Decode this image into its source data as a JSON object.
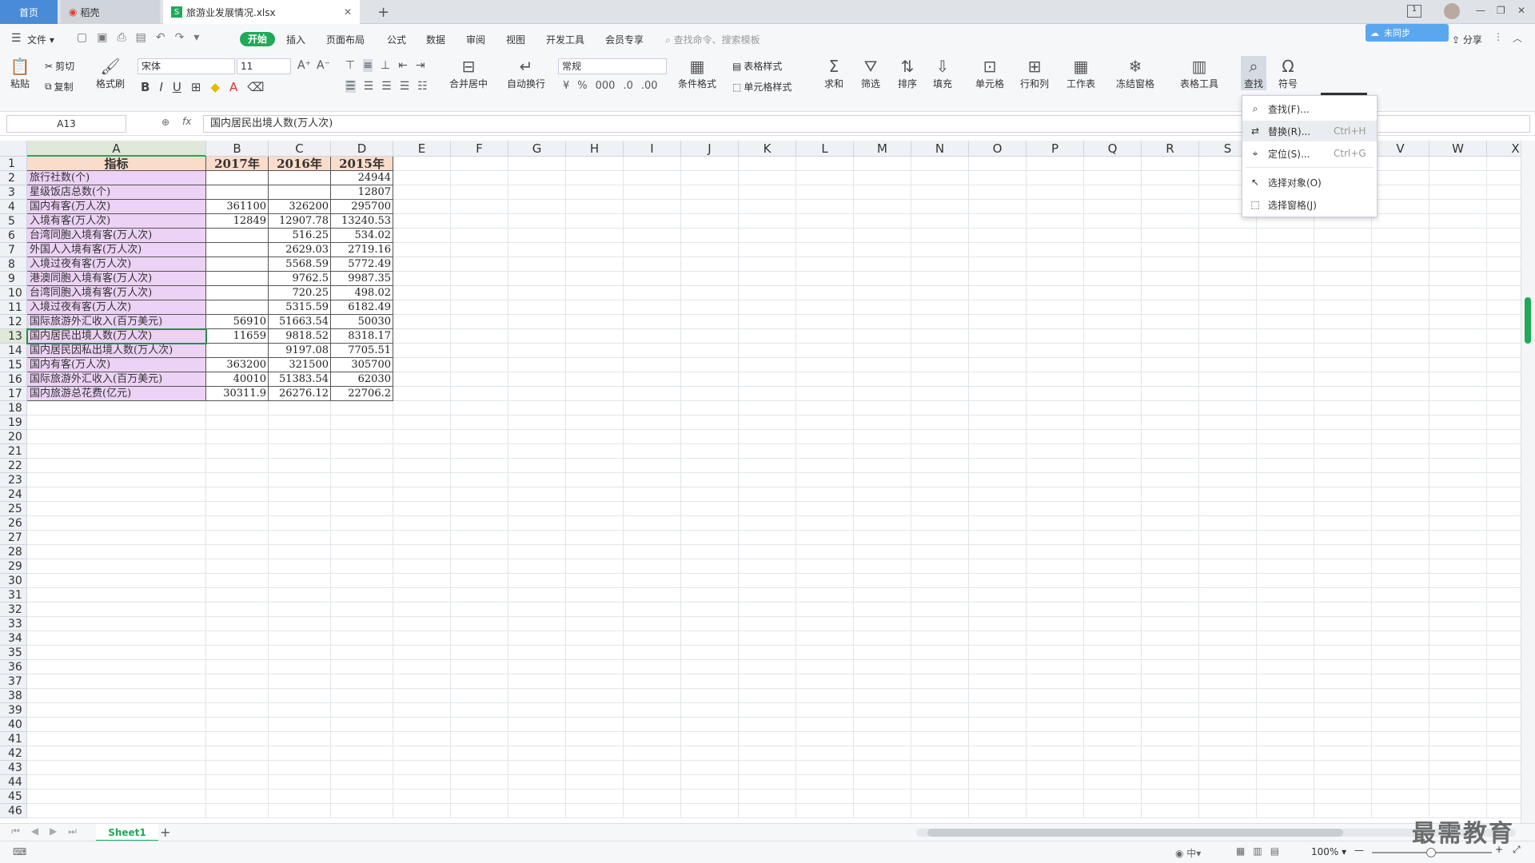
{
  "tabs": {
    "home": "首页",
    "daoke": "稻壳",
    "file": "旅游业发展情况.xlsx",
    "new_tab": "+"
  },
  "window_controls": {
    "min": "—",
    "max": "❐",
    "close": "✕"
  },
  "menu": {
    "file": "文件",
    "items": [
      "开始",
      "插入",
      "页面布局",
      "公式",
      "数据",
      "审阅",
      "视图",
      "开发工具",
      "会员专享"
    ],
    "search_placeholder": "查找命令、搜索模板",
    "share": "分享",
    "collab": "未同步"
  },
  "ribbon": {
    "paste": "粘贴",
    "cut": "剪切",
    "copy": "复制",
    "format_painter": "格式刷",
    "font_name": "宋体",
    "font_size": "11",
    "merge": "合并居中",
    "wrap": "自动换行",
    "number_format": "常规",
    "cond_format": "条件格式",
    "table_style": "表格样式",
    "cell_style": "单元格样式",
    "sum": "求和",
    "filter": "筛选",
    "sort": "排序",
    "fill": "填充",
    "cell": "单元格",
    "rowcol": "行和列",
    "sheet": "工作表",
    "freeze": "冻结窗格",
    "table_tools": "表格工具",
    "find": "查找",
    "symbol": "符号"
  },
  "formula": {
    "name_box": "A13",
    "fx": "fx",
    "content": "国内居民出境人数(万人次)"
  },
  "columns": [
    "A",
    "B",
    "C",
    "D",
    "E",
    "F",
    "G",
    "H",
    "I",
    "J",
    "K",
    "L",
    "M",
    "N",
    "O",
    "P",
    "Q",
    "R",
    "S",
    "T",
    "U",
    "V",
    "W",
    "X"
  ],
  "rows": [
    "1",
    "2",
    "3",
    "4",
    "5",
    "6",
    "7",
    "8",
    "9",
    "10",
    "11",
    "12",
    "13",
    "14",
    "15",
    "16",
    "17",
    "18",
    "19",
    "20",
    "21",
    "22",
    "23",
    "24",
    "25",
    "26",
    "27",
    "28",
    "29",
    "30",
    "31",
    "32",
    "33",
    "34",
    "35",
    "36",
    "37",
    "38",
    "39",
    "40",
    "41",
    "42",
    "43",
    "44",
    "45",
    "46"
  ],
  "table": {
    "header": [
      "指标",
      "2017年",
      "2016年",
      "2015年"
    ],
    "rows": [
      [
        "旅行社数(个)",
        "",
        "",
        "24944"
      ],
      [
        "星级饭店总数(个)",
        "",
        "",
        "12807"
      ],
      [
        "国内有客(万人次)",
        "361100",
        "326200",
        "295700"
      ],
      [
        "入境有客(万人次)",
        "12849",
        "12907.78",
        "13240.53"
      ],
      [
        "台湾同胞入境有客(万人次)",
        "",
        "516.25",
        "534.02"
      ],
      [
        "外国人入境有客(万人次)",
        "",
        "2629.03",
        "2719.16"
      ],
      [
        "入境过夜有客(万人次)",
        "",
        "5568.59",
        "5772.49"
      ],
      [
        "港澳同胞入境有客(万人次)",
        "",
        "9762.5",
        "9987.35"
      ],
      [
        "台湾同胞入境有客(万人次)",
        "",
        "720.25",
        "498.02"
      ],
      [
        "入境过夜有客(万人次)",
        "",
        "5315.59",
        "6182.49"
      ],
      [
        "国际旅游外汇收入(百万美元)",
        "56910",
        "51663.54",
        "50030"
      ],
      [
        "国内居民出境人数(万人次)",
        "11659",
        "9818.52",
        "8318.17"
      ],
      [
        "国内居民因私出境人数(万人次)",
        "",
        "9197.08",
        "7705.51"
      ],
      [
        "国内有客(万人次)",
        "363200",
        "321500",
        "305700"
      ],
      [
        "国际旅游外汇收入(百万美元)",
        "40010",
        "51383.54",
        "62030"
      ],
      [
        "国内旅游总花费(亿元)",
        "30311.9",
        "26276.12",
        "22706.2"
      ]
    ]
  },
  "find_menu": [
    {
      "label": "查找(F)...",
      "shortcut": ""
    },
    {
      "label": "替换(R)...",
      "shortcut": "Ctrl+H"
    },
    {
      "label": "定位(S)...",
      "shortcut": "Ctrl+G"
    },
    {
      "label": "选择对象(O)",
      "shortcut": ""
    },
    {
      "label": "选择窗格(J)",
      "shortcut": ""
    }
  ],
  "sheet": {
    "name": "Sheet1",
    "add": "+"
  },
  "status": {
    "zoom": "100%"
  },
  "watermark": "最需教育",
  "colors": {
    "accent": "#1eaa59",
    "label_bg": "#ecd2f5",
    "header_bg": "#fadccb",
    "selected": "#1f8f4e"
  }
}
